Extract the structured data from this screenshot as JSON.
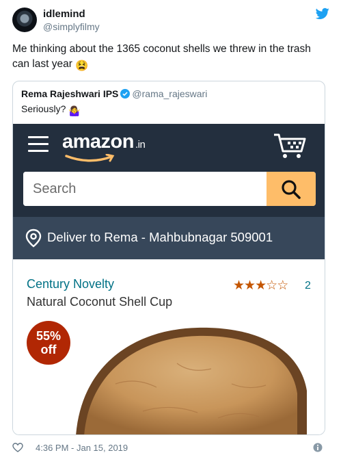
{
  "tweet": {
    "display_name": "idlemind",
    "handle": "@simplyfilmy",
    "text": "Me thinking about the 1365 coconut shells we threw in the trash can last year",
    "emoji": "😫",
    "timestamp": "4:36 PM - Jan 15, 2019",
    "icons": {
      "brand": "twitter-bird-icon",
      "like": "heart-icon",
      "info": "info-icon"
    }
  },
  "quote": {
    "display_name": "Rema Rajeshwari IPS",
    "handle": "@rama_rajeswari",
    "text": "Seriously?",
    "emoji": "🤷‍♀️"
  },
  "amazon": {
    "logo_text": "amazon",
    "logo_tld": ".in",
    "search": {
      "placeholder": "Search"
    },
    "deliver_text": "Deliver to Rema - Mahbubnagar 509001",
    "product": {
      "brand": "Century Novelty",
      "title": "Natural Coconut Shell Cup",
      "rating": 3,
      "rating_max": 5,
      "review_count": "2",
      "discount_line1": "55%",
      "discount_line2": "off"
    },
    "colors": {
      "header_bg": "#232f3e",
      "deliver_bg": "#37475a",
      "search_button": "#febd69",
      "link": "#007185",
      "star": "#c45500",
      "badge": "#b12704",
      "smile": "#febd69"
    }
  }
}
